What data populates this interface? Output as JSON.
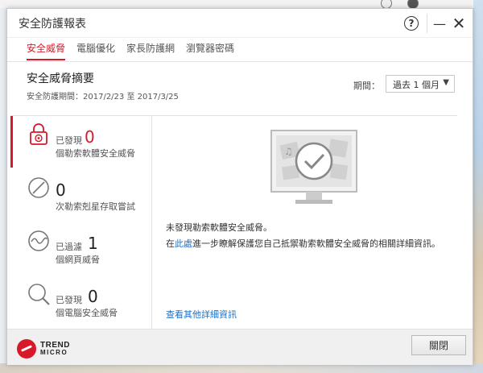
{
  "window": {
    "title": "安全防護報表"
  },
  "titlebar": {
    "help_label": "?",
    "minimize_label": "—",
    "close_label": "✕"
  },
  "tabs": [
    {
      "label": "安全威脅",
      "active": true
    },
    {
      "label": "電腦優化",
      "active": false
    },
    {
      "label": "家長防護網",
      "active": false
    },
    {
      "label": "瀏覽器密碼",
      "active": false
    }
  ],
  "summary": {
    "title": "安全威脅摘要",
    "period_text": "安全防護期間：2017/2/23 至 2017/3/25",
    "period_label": "期間：",
    "period_value": "過去 1 個月"
  },
  "stats": [
    {
      "prefix": "已發現",
      "count": "0",
      "desc": "個勒索軟體安全威脅",
      "icon": "ransomware-lock-icon"
    },
    {
      "prefix": "",
      "count": "0",
      "desc": "次勒索剋星存取嘗試",
      "icon": "blocked-circle-icon"
    },
    {
      "prefix": "已過濾",
      "count": "1",
      "desc": "個網頁威脅",
      "icon": "web-wave-icon"
    },
    {
      "prefix": "已發現",
      "count": "0",
      "desc": "個電腦安全威脅",
      "icon": "magnifier-icon"
    }
  ],
  "detail": {
    "message": "未發現勒索軟體安全威脅。",
    "hint_prefix": "在",
    "hint_link": "此處",
    "hint_suffix": "進一步瞭解保護您自己抵禦勒索軟體安全威脅的相關詳細資訊。",
    "more_link": "查看其他詳細資訊"
  },
  "footer": {
    "logo_line1": "TREND",
    "logo_line2": "MICRO",
    "close_button": "關閉"
  },
  "colors": {
    "accent": "#d7192a",
    "link": "#1a6fc9"
  }
}
